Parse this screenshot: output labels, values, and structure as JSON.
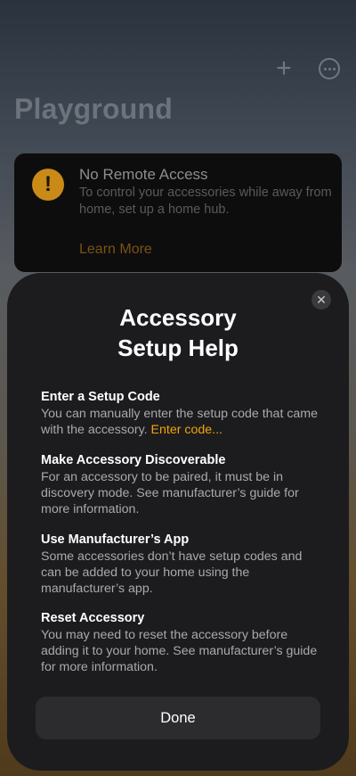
{
  "header": {
    "title": "Playground",
    "add_icon": "plus-icon",
    "more_icon": "ellipsis-circle-icon"
  },
  "alert": {
    "icon": "exclamation-icon",
    "icon_glyph": "!",
    "title": "No Remote Access",
    "body": "To control your accessories while away from home, set up a home hub.",
    "link": "Learn More"
  },
  "sheet": {
    "close_glyph": "✕",
    "title_line1": "Accessory",
    "title_line2": "Setup Help",
    "sections": [
      {
        "heading": "Enter a Setup Code",
        "body": "You can manually enter the setup code that came with the accessory. ",
        "link": "Enter code..."
      },
      {
        "heading": "Make Accessory Discoverable",
        "body": "For an accessory to be paired, it must be in discovery mode. See manufacturer’s guide for more information."
      },
      {
        "heading": "Use Manufacturer’s App",
        "body": "Some accessories don’t have setup codes and can be added to your home using the manufacturer’s app."
      },
      {
        "heading": "Reset Accessory",
        "body": "You may need to reset the accessory before adding it to your home. See manufacturer’s guide for more information."
      }
    ],
    "done_label": "Done"
  },
  "colors": {
    "accent": "#f0a30a",
    "sheet_bg": "#1c1c1e",
    "button_bg": "#2c2c2e"
  }
}
